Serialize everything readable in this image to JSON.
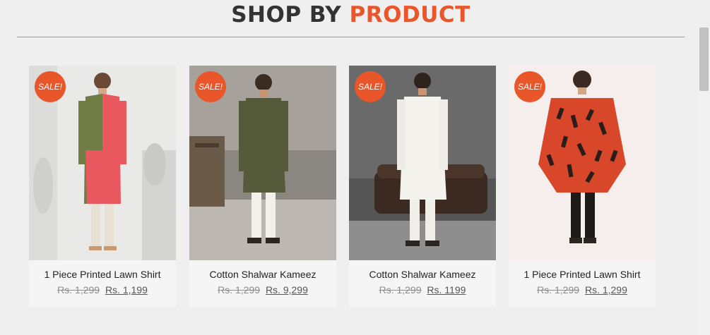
{
  "heading": {
    "word1": "SHOP BY",
    "word2": "PRODUCT"
  },
  "products": [
    {
      "badge": "SALE!",
      "title": "1 Piece Printed Lawn Shirt",
      "old_price": "Rs. 1,299",
      "new_price": "Rs. 1,199"
    },
    {
      "badge": "SALE!",
      "title": "Cotton Shalwar Kameez",
      "old_price": "Rs. 1,299",
      "new_price": "Rs. 9,299"
    },
    {
      "badge": "SALE!",
      "title": "Cotton Shalwar Kameez",
      "old_price": "Rs. 1,299",
      "new_price": "Rs. 1199"
    },
    {
      "badge": "SALE!",
      "title": "1 Piece Printed Lawn Shirt",
      "old_price": "Rs. 1,299",
      "new_price": "Rs. 1,299"
    }
  ],
  "colors": {
    "accent": "#e8562a",
    "heading": "#333333"
  }
}
